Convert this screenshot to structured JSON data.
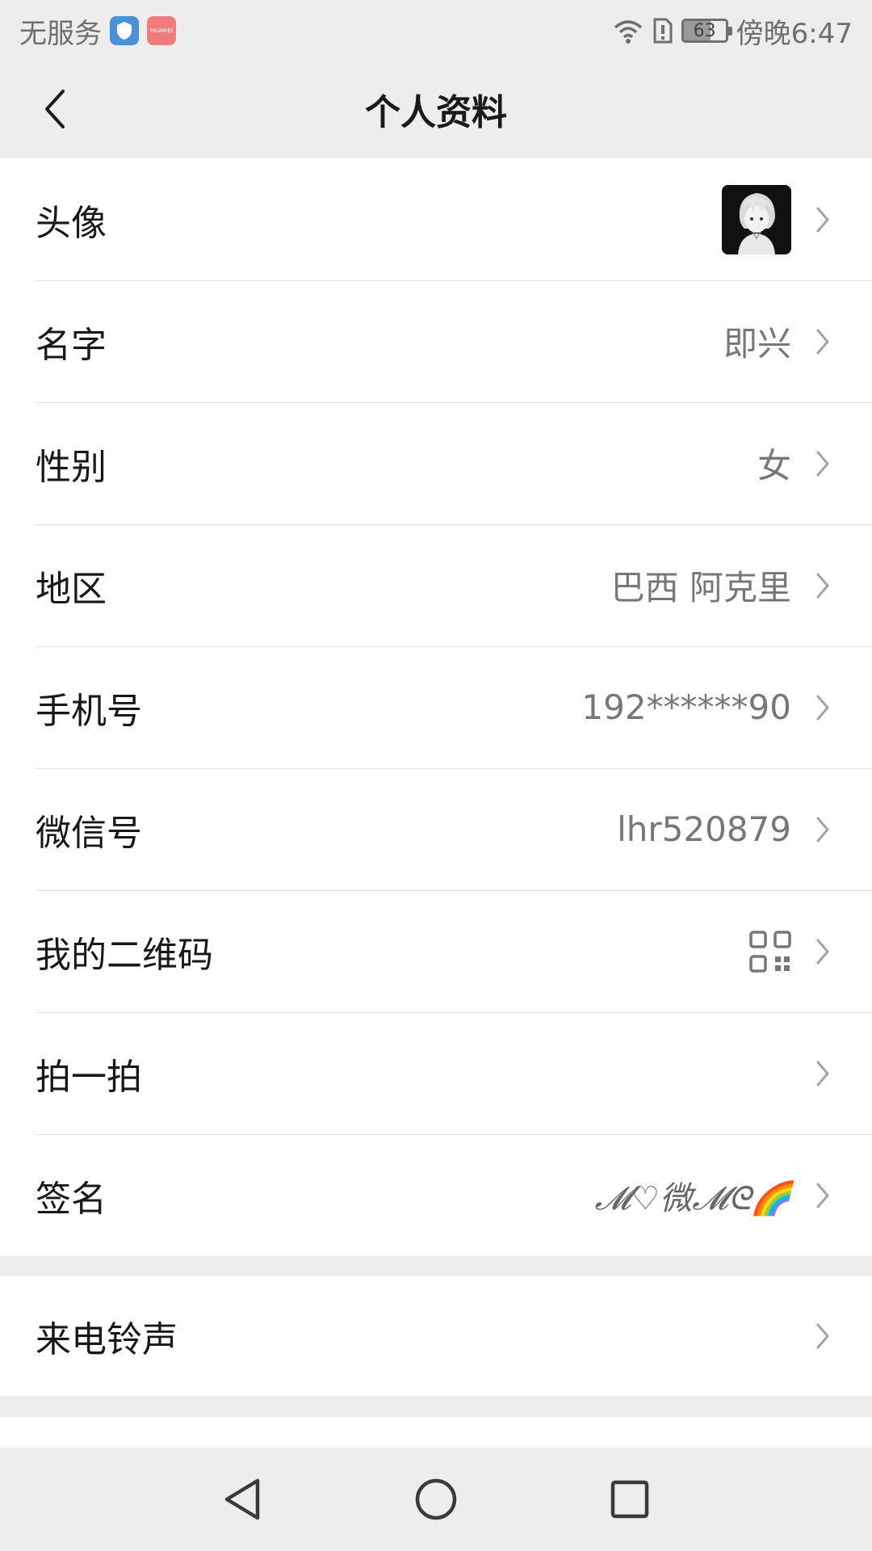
{
  "status_bar": {
    "carrier": "无服务",
    "store_badge": "HUAWEI",
    "battery": "63",
    "time": "傍晚6:47"
  },
  "header": {
    "title": "个人资料",
    "back_icon": "chevron-left-icon"
  },
  "profile": {
    "rows": [
      {
        "label": "头像",
        "value": ""
      },
      {
        "label": "名字",
        "value": "即兴"
      },
      {
        "label": "性别",
        "value": "女"
      },
      {
        "label": "地区",
        "value": "巴西 阿克里"
      },
      {
        "label": "手机号",
        "value": "192******90"
      },
      {
        "label": "微信号",
        "value": "lhr520879"
      },
      {
        "label": "我的二维码",
        "value": ""
      },
      {
        "label": "拍一拍",
        "value": ""
      },
      {
        "label": "签名",
        "value": "𝓜♡微𝓜ᘓ🌈"
      }
    ]
  },
  "more": {
    "rows": [
      {
        "label": "来电铃声",
        "value": ""
      }
    ]
  },
  "nav": {
    "back": "triangle-back-icon",
    "home": "circle-home-icon",
    "recents": "square-recents-icon"
  },
  "colors": {
    "background": "#ededed",
    "card": "#ffffff",
    "secondary_text": "#777777"
  }
}
